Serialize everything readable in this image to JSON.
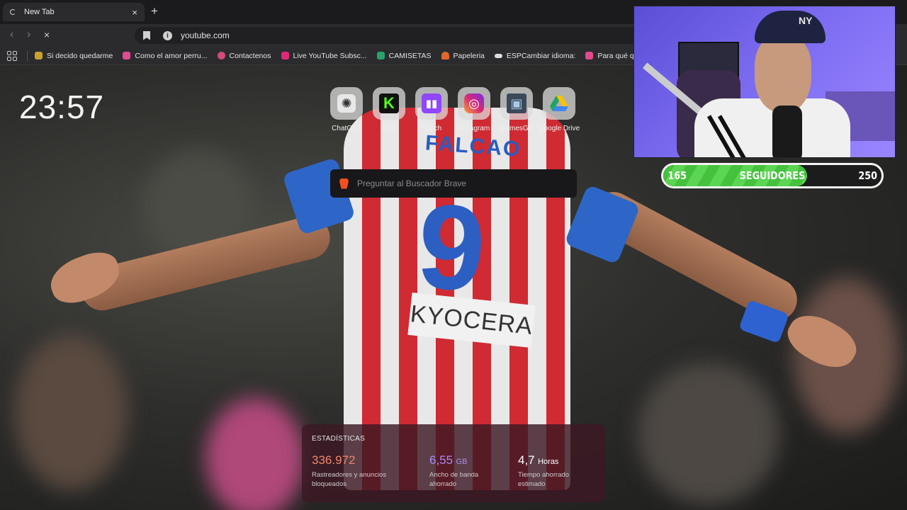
{
  "tab": {
    "title": "New Tab",
    "close": "×",
    "new_tab": "+"
  },
  "toolbar": {
    "back": "‹",
    "forward": "›",
    "reload": "×",
    "url": "youtube.com",
    "info": "i"
  },
  "bookmarks": [
    {
      "label": "Si decido quedarme",
      "color": "#c9a227"
    },
    {
      "label": "Como el amor perru...",
      "color": "#e04b8f"
    },
    {
      "label": "Contactenos",
      "color": "#d24a7c"
    },
    {
      "label": "Live YouTube Subsc...",
      "color": "#e0287a"
    },
    {
      "label": "CAMISETAS",
      "color": "#29a36a"
    },
    {
      "label": "Papeleria",
      "color": "#e0672a"
    },
    {
      "label": "ESPCambiar idioma:",
      "color": "#dddddd"
    },
    {
      "label": "Para qué quiero asp",
      "color": "#e04b8f"
    }
  ],
  "clock": "23:57",
  "shortcuts": [
    {
      "label": "ChatGPT",
      "icon": "chatgpt-icon",
      "glyph": "✺",
      "bg": "#e8e8e8",
      "fg": "#333333"
    },
    {
      "label": "Kick",
      "icon": "kick-icon",
      "glyph": "K",
      "bg": "#111111",
      "fg": "#53fc18"
    },
    {
      "label": "Twitch",
      "icon": "twitch-icon",
      "glyph": "💬",
      "bg": "#9146ff",
      "fg": "#ffffff"
    },
    {
      "label": "Instagram",
      "icon": "instagram-icon",
      "glyph": "◎",
      "bg": "#d62976",
      "fg": "#ffffff"
    },
    {
      "label": "GamesGX",
      "icon": "gamesgx-icon",
      "glyph": "▣",
      "bg": "#3a4a5a",
      "fg": "#a8c8e8"
    },
    {
      "label": "Google Drive",
      "icon": "google-drive-icon",
      "glyph": "▲",
      "bg": "#e8e8e8",
      "fg": "#1fa463"
    }
  ],
  "search": {
    "placeholder": "Preguntar al Buscador Brave"
  },
  "stats": {
    "heading": "ESTADÍSTICAS",
    "trackers": {
      "value": "336.972",
      "desc1": "Rastreadores y anuncios",
      "desc2": "bloqueados",
      "color": "#f0856a"
    },
    "bandwidth": {
      "value": "6,55",
      "unit": "GB",
      "desc1": "Ancho de banda",
      "desc2": "ahorrado",
      "color": "#a78cf5"
    },
    "time": {
      "value": "4,7",
      "unit": "Horas",
      "desc1": "Tiempo ahorrado",
      "desc2": "estimado",
      "color": "#ffffff"
    }
  },
  "jersey": {
    "name": "FALCAO",
    "number": "9",
    "sponsor": "KYOCERA"
  },
  "webcam": {
    "cap_logo": "NY"
  },
  "goal": {
    "current": "165",
    "label": "SEGUIDORES",
    "target": "250",
    "progress": 0.66
  }
}
